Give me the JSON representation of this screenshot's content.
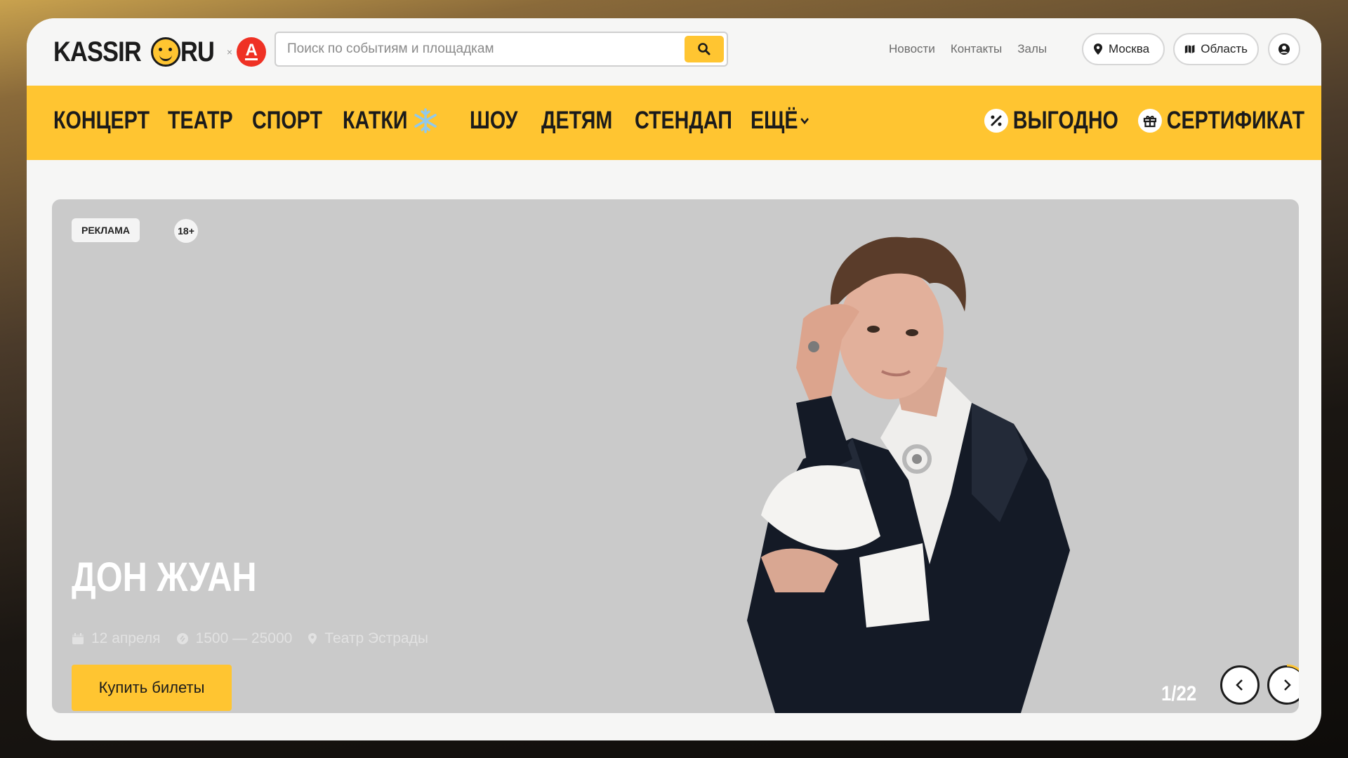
{
  "header": {
    "logo_text_left": "KASSIR",
    "logo_text_right": "RU",
    "logo_x": "×",
    "partner_letter": "A",
    "search_placeholder": "Поиск по событиям и площадкам",
    "links": [
      "Новости",
      "Контакты",
      "Залы"
    ],
    "city": "Москва",
    "region": "Область"
  },
  "nav": {
    "items": [
      "КОНЦЕРТ",
      "ТЕАТР",
      "СПОРТ",
      "КАТКИ",
      "ШОУ",
      "ДЕТЯМ",
      "СТЕНДАП",
      "ЕЩЁ"
    ],
    "promo": "ВЫГОДНО",
    "certificate": "СЕРТИФИКАТ"
  },
  "banner": {
    "ad_label": "РЕКЛАМА",
    "age_label": "18+",
    "title": "ДОН ЖУАН",
    "date": "12 апреля",
    "price": "1500 — 25000",
    "venue": "Театр Эстрады",
    "buy_label": "Купить билеты",
    "counter": "1/22"
  },
  "colors": {
    "accent": "#ffc531",
    "partner_red": "#ef3124",
    "banner_bg": "#cacaca"
  }
}
